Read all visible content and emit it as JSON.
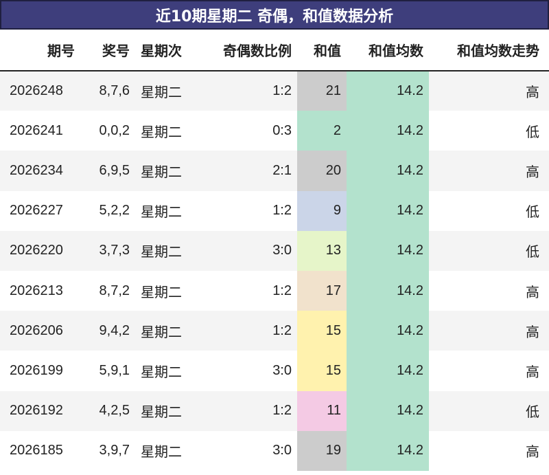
{
  "title": "近10期星期二 奇偶，和值数据分析",
  "headers": {
    "issue": "期号",
    "numbers": "奖号",
    "weekday": "星期次",
    "odd_even": "奇偶数比例",
    "sum": "和值",
    "sum_avg": "和值均数",
    "sum_trend": "和值均数走势"
  },
  "colors": {
    "title_bg": "#3e3e7c",
    "avg_bg": "#b3e2cd"
  },
  "rows": [
    {
      "issue": "2026248",
      "numbers": "8,7,6",
      "weekday": "星期二",
      "odd_even": "1:2",
      "sum": "21",
      "sum_color": "#cccccc",
      "avg": "14.2",
      "trend": "高"
    },
    {
      "issue": "2026241",
      "numbers": "0,0,2",
      "weekday": "星期二",
      "odd_even": "0:3",
      "sum": "2",
      "sum_color": "#b3e2cd",
      "avg": "14.2",
      "trend": "低"
    },
    {
      "issue": "2026234",
      "numbers": "6,9,5",
      "weekday": "星期二",
      "odd_even": "2:1",
      "sum": "20",
      "sum_color": "#cccccc",
      "avg": "14.2",
      "trend": "高"
    },
    {
      "issue": "2026227",
      "numbers": "5,2,2",
      "weekday": "星期二",
      "odd_even": "1:2",
      "sum": "9",
      "sum_color": "#cbd5e8",
      "avg": "14.2",
      "trend": "低"
    },
    {
      "issue": "2026220",
      "numbers": "3,7,3",
      "weekday": "星期二",
      "odd_even": "3:0",
      "sum": "13",
      "sum_color": "#e6f5c9",
      "avg": "14.2",
      "trend": "低"
    },
    {
      "issue": "2026213",
      "numbers": "8,7,2",
      "weekday": "星期二",
      "odd_even": "1:2",
      "sum": "17",
      "sum_color": "#f1e2cc",
      "avg": "14.2",
      "trend": "高"
    },
    {
      "issue": "2026206",
      "numbers": "9,4,2",
      "weekday": "星期二",
      "odd_even": "1:2",
      "sum": "15",
      "sum_color": "#fff2ae",
      "avg": "14.2",
      "trend": "高"
    },
    {
      "issue": "2026199",
      "numbers": "5,9,1",
      "weekday": "星期二",
      "odd_even": "3:0",
      "sum": "15",
      "sum_color": "#fff2ae",
      "avg": "14.2",
      "trend": "高"
    },
    {
      "issue": "2026192",
      "numbers": "4,2,5",
      "weekday": "星期二",
      "odd_even": "1:2",
      "sum": "11",
      "sum_color": "#f4cae4",
      "avg": "14.2",
      "trend": "低"
    },
    {
      "issue": "2026185",
      "numbers": "3,9,7",
      "weekday": "星期二",
      "odd_even": "3:0",
      "sum": "19",
      "sum_color": "#cccccc",
      "avg": "14.2",
      "trend": "高"
    }
  ]
}
